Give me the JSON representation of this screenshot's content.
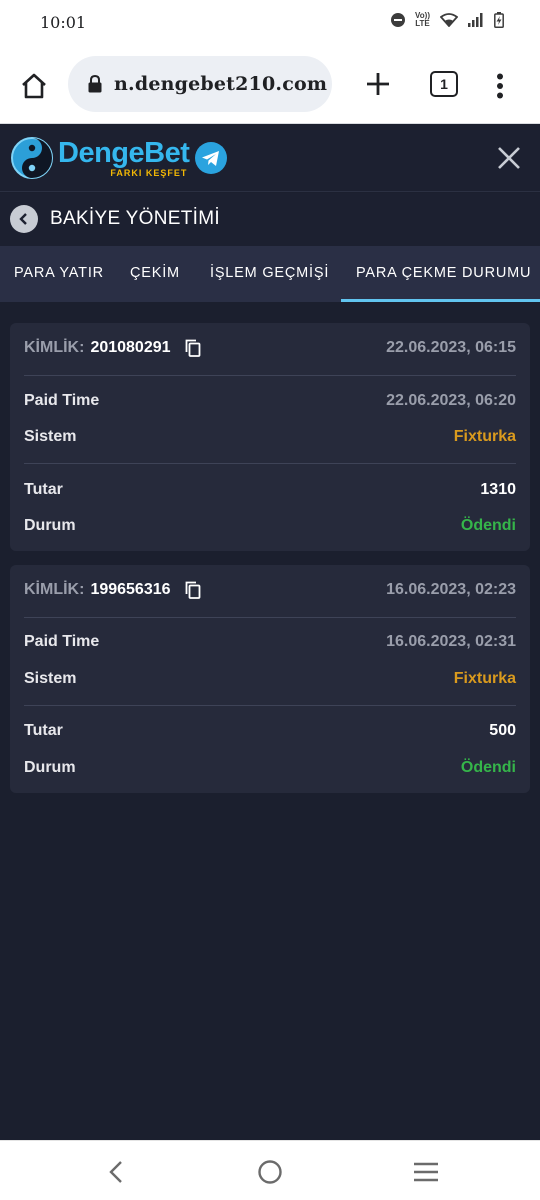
{
  "status_bar": {
    "time": "10:01",
    "network_label_top": "Vo))",
    "network_label_bottom": "LTE"
  },
  "browser": {
    "url": "n.dengebet210.com",
    "tab_count": "1"
  },
  "site": {
    "logo_part1": "Denge",
    "logo_part2": "Bet",
    "slogan": "FARKI KEŞFET"
  },
  "page": {
    "title": "BAKİYE YÖNETİMİ"
  },
  "tabs": [
    {
      "label": "PARA YATIR",
      "active": false
    },
    {
      "label": "ÇEKİM",
      "active": false
    },
    {
      "label": "İŞLEM GEÇMİŞİ",
      "active": false
    },
    {
      "label": "PARA ÇEKME DURUMU",
      "active": true
    }
  ],
  "labels": {
    "id": "KİMLİK:",
    "paid_time": "Paid Time",
    "system": "Sistem",
    "amount": "Tutar",
    "status": "Durum"
  },
  "withdrawals": [
    {
      "id": "201080291",
      "created": "22.06.2023, 06:15",
      "paid_time": "22.06.2023, 06:20",
      "system": "Fixturka",
      "amount": "1310",
      "status": "Ödendi"
    },
    {
      "id": "199656316",
      "created": "16.06.2023, 02:23",
      "paid_time": "16.06.2023, 02:31",
      "system": "Fixturka",
      "amount": "500",
      "status": "Ödendi"
    }
  ],
  "colors": {
    "accent": "#61c4ef",
    "system_text": "#d99a1e",
    "status_paid": "#35b54a",
    "background": "#1b1f2e"
  },
  "icons": [
    "home-icon",
    "lock-icon",
    "plus-icon",
    "tabs-icon",
    "more-vert-icon",
    "yin-yang-logo-icon",
    "telegram-icon",
    "close-icon",
    "back-arrow-icon",
    "copy-icon",
    "nav-back-icon",
    "nav-home-icon",
    "nav-recents-icon"
  ]
}
